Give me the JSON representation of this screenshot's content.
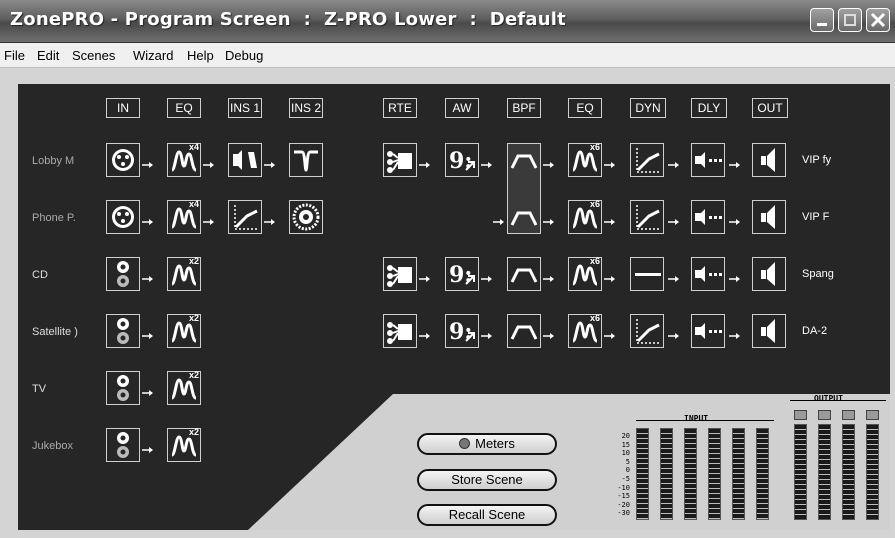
{
  "window": {
    "title": "ZonePRO - Program Screen  :  Z-PRO Lower  :  Default"
  },
  "menu": [
    "File",
    "Edit",
    "Scenes",
    "Wizard",
    "Help",
    "Debug"
  ],
  "columns": {
    "left": [
      "IN",
      "EQ",
      "INS 1",
      "INS 2"
    ],
    "right": [
      "RTE",
      "AW",
      "BPF",
      "EQ",
      "DYN",
      "DLY",
      "OUT"
    ]
  },
  "inputs": [
    {
      "name": "Lobby M",
      "eq_multiplier": "x4",
      "inserts": [
        "gate",
        "compressor"
      ],
      "routed": true,
      "output": "VIP fy",
      "dyn": "compressor"
    },
    {
      "name": "Phone P.",
      "eq_multiplier": "x4",
      "inserts": [
        "compressor",
        "agc"
      ],
      "routed": false,
      "output": "VIP F",
      "dyn": "compressor"
    },
    {
      "name": "CD",
      "eq_multiplier": "x2",
      "inserts": [],
      "routed": true,
      "output": "Spang",
      "dyn": "bypass"
    },
    {
      "name": "Satellite )",
      "eq_multiplier": "x2",
      "inserts": [],
      "routed": true,
      "output": "DA-2",
      "dyn": "compressor"
    },
    {
      "name": "TV",
      "eq_multiplier": "x2",
      "inserts": [],
      "routed": false
    },
    {
      "name": "Jukebox",
      "eq_multiplier": "x2",
      "inserts": [],
      "routed": false
    }
  ],
  "output_eq_multiplier": "x6",
  "controls": {
    "meters": "Meters",
    "store": "Store Scene",
    "recall": "Recall Scene"
  },
  "meters": {
    "input_label": "INPUT",
    "output_label": "OUTPUT",
    "scale": [
      "20",
      "15",
      "10",
      "5",
      "0",
      "-5",
      "-10",
      "-15",
      "-20",
      "-30"
    ],
    "input_levels": [
      0,
      0,
      0,
      0,
      0,
      0
    ],
    "output_levels": [
      0,
      0,
      0,
      0
    ]
  }
}
